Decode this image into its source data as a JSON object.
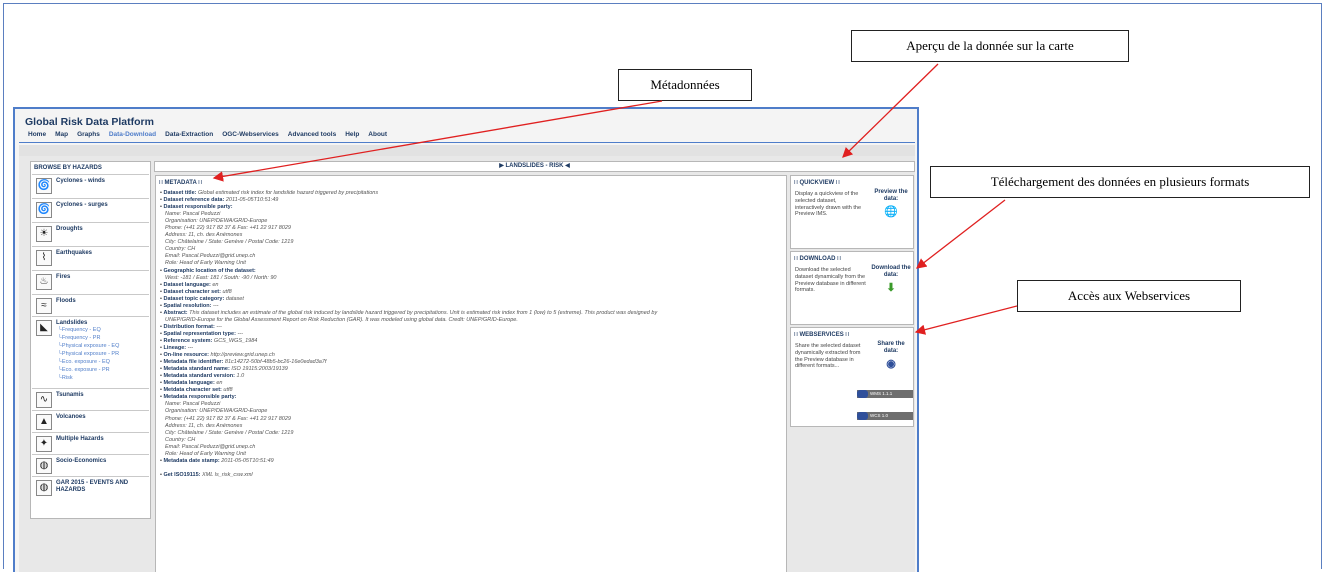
{
  "callouts": {
    "apercu": "Aperçu de la donnée sur la carte",
    "metadonnees": "Métadonnées",
    "telechargement": "Téléchargement des données en plusieurs formats",
    "webservices": "Accès aux Webservices"
  },
  "platform_title": "Global Risk Data Platform",
  "nav": [
    "Home",
    "Map",
    "Graphs",
    "Data-Download",
    "Data-Extraction",
    "OGC-Webservices",
    "Advanced tools",
    "Help",
    "About"
  ],
  "sidebar": {
    "heading": "BROWSE BY HAZARDS",
    "hazards": [
      "Cyclones - winds",
      "Cyclones - surges",
      "Droughts",
      "Earthquakes",
      "Fires",
      "Floods",
      "Landslides",
      "Tsunamis",
      "Volcanoes",
      "Multiple Hazards",
      "Socio-Economics",
      "GAR 2015 - EVENTS AND HAZARDS"
    ],
    "landslide_subitems": [
      "Frequency - EQ",
      "Frequency - PR",
      "Physical exposure - EQ",
      "Physical exposure - PR",
      "Eco. exposure - EQ",
      "Eco. exposure - PR",
      "Risk"
    ]
  },
  "dataset_title": "LANDSLIDES - RISK",
  "metadata": {
    "heading": "METADATA",
    "lines": [
      {
        "b": "Dataset title:",
        "v": "Global estimated risk index for landslide hazard triggered by precipitations"
      },
      {
        "b": "Dataset reference data:",
        "v": "2011-05-05T10:51:49"
      },
      {
        "b": "Dataset responsible party:",
        "v": ""
      },
      {
        "b": "",
        "v": "Name: Pascal Peduzzi"
      },
      {
        "b": "",
        "v": "Organisation: UNEP/DEWA/GRID-Europe"
      },
      {
        "b": "",
        "v": "Phone: (+41 22) 917 82 37 & Fax: +41 22 917 8029"
      },
      {
        "b": "",
        "v": "Address: 11, ch. des Anémones"
      },
      {
        "b": "",
        "v": "City: Châtelaine / State: Genève / Postal Code: 1219"
      },
      {
        "b": "",
        "v": "Country: CH"
      },
      {
        "b": "",
        "v": "Email: Pascal.Peduzzi@grid.unep.ch"
      },
      {
        "b": "",
        "v": "Role: Head of Early Warning Unit"
      },
      {
        "b": "Geographic location of the dataset:",
        "v": ""
      },
      {
        "b": "",
        "v": "West: -181 / East: 181 / South: -90 / North: 90"
      },
      {
        "b": "Dataset language:",
        "v": "en"
      },
      {
        "b": "Dataset character set:",
        "v": "utf8"
      },
      {
        "b": "Dataset topic category:",
        "v": "dataset"
      },
      {
        "b": "Spatial resolution:",
        "v": "---"
      },
      {
        "b": "Abstract:",
        "v": "This dataset includes an estimate of the global risk induced by landslide hazard triggered by precipitations. Unit is estimated risk index from 1 (low) to 5 (extreme). This product was designed by"
      },
      {
        "b": "",
        "v": "UNEP/GRID-Europe for the Global Assessment Report on Risk Reduction (GAR). It was modeled using global data. Credit: UNEP/GRID-Europe."
      },
      {
        "b": "Distribution format:",
        "v": "---"
      },
      {
        "b": "Spatial representation type:",
        "v": "---"
      },
      {
        "b": "Reference system:",
        "v": "GCS_WGS_1984"
      },
      {
        "b": "Lineage:",
        "v": "---"
      },
      {
        "b": "On-line resource:",
        "v": "http://preview.grid.unep.ch"
      },
      {
        "b": "Metadata file identifier:",
        "v": "81c14272-50bf-48b5-bc26-16e0edad3a7f"
      },
      {
        "b": "Metadata standard name:",
        "v": "ISO 19115:2003/19139"
      },
      {
        "b": "Metadata standard version:",
        "v": "1.0"
      },
      {
        "b": "Metadata language:",
        "v": "en"
      },
      {
        "b": "Metdata character set:",
        "v": "utf8"
      },
      {
        "b": "Metadata responsible party:",
        "v": ""
      },
      {
        "b": "",
        "v": "Name: Pascal Peduzzi"
      },
      {
        "b": "",
        "v": "Organisation: UNEP/DEWA/GRID-Europe"
      },
      {
        "b": "",
        "v": "Phone: (+41 22) 917 82 37 & Fax: +41 22 917 8029"
      },
      {
        "b": "",
        "v": "Address: 11, ch. des Anémones"
      },
      {
        "b": "",
        "v": "City: Châtelaine / State: Genève / Postal Code: 1219"
      },
      {
        "b": "",
        "v": "Country: CH"
      },
      {
        "b": "",
        "v": "Email: Pascal.Peduzzi@grid.unep.ch"
      },
      {
        "b": "",
        "v": "Role: Head of Early Warning Unit"
      },
      {
        "b": "Metadata date stamp:",
        "v": "2011-05-05T10:51:49"
      },
      {
        "b": "",
        "v": ""
      },
      {
        "b": "Get ISO19115:",
        "v": "XML  ls_risk_csw.xml"
      }
    ]
  },
  "quickview": {
    "heading": "QUICKVIEW",
    "text": "Display a quickview of the selected dataset, interactively drawn with the Preview IMS.",
    "action": "Preview the data:"
  },
  "download": {
    "heading": "DOWNLOAD",
    "text": "Download the selected dataset dynamically from the Preview database in different formats.",
    "action": "Download the data:"
  },
  "webservices": {
    "heading": "WEBSERVICES",
    "text": "Share the selected dataset dynamically extracted from the Preview database in different formats...",
    "action": "Share the data:",
    "badges": [
      "WMS 1.1.1",
      "WCS 1.0"
    ]
  },
  "icons": [
    "cyclone-icon",
    "drought-icon",
    "earthquake-icon",
    "fire-icon",
    "flood-icon",
    "landslide-icon",
    "tsunami-icon",
    "volcano-icon",
    "multiple-hazards-icon",
    "globe-icon",
    "download-icon"
  ],
  "colors": {
    "accent": "#4f7dc9",
    "title": "#1f3b63",
    "arrow": "#e02020"
  }
}
